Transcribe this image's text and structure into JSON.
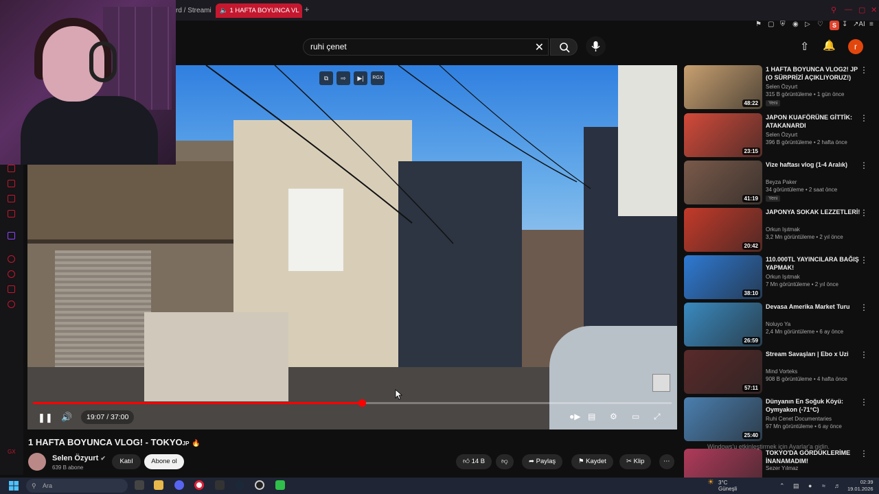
{
  "browser": {
    "prev_tab_label": "rd / Streami",
    "active_tab_label": "1 HAFTA BOYUNCA VL",
    "new_tab_icon": "plus-icon",
    "accent": "#c4182f"
  },
  "search": {
    "value": "ruhi çenet",
    "clear_icon": "close-icon",
    "search_icon": "search-icon",
    "mic_icon": "mic-icon"
  },
  "header": {
    "upload_icon": "upload-icon",
    "bell_icon": "bell-icon",
    "avatar_letter": "r"
  },
  "player": {
    "current_time": "19:07",
    "duration": "37:00",
    "time_display": "19:07 / 37:00",
    "progress_fraction": 0.515,
    "top_icons": [
      "copy-icon",
      "pip-icon",
      "next-icon",
      "RGX"
    ],
    "accent": "#ff0000"
  },
  "video": {
    "title": "1 HAFTA BOYUNCA VLOG! - TOKYO",
    "title_suffix": "JP",
    "channel": "Selen Özyurt",
    "subscribers": "639 B abone",
    "join_label": "Katıl",
    "subscribe_label": "Abone ol",
    "likes": "14 B",
    "share_label": "Paylaş",
    "save_label": "Kaydet",
    "clip_label": "Klip"
  },
  "recommendations": [
    {
      "title": "1 HAFTA BOYUNCA VLOG2! JP (O SÜRPRİZİ AÇIKLIYORUZ!)",
      "channel": "Selen Özyurt",
      "meta": "315 B görüntüleme • 1 gün önce",
      "duration": "48:22",
      "badge": "Yeni",
      "color": "#c8a070"
    },
    {
      "title": "JAPON KUAFÖRÜNE GİTTİK: ATAKANARDI",
      "channel": "Selen Özyurt",
      "meta": "396 B görüntüleme • 2 hafta önce",
      "duration": "23:15",
      "badge": "",
      "color": "#d34a3a"
    },
    {
      "title": "Vize haftası vlog (1-4 Aralık)",
      "channel": "Beyza Paker",
      "meta": "34 görüntüleme • 2 saat önce",
      "duration": "41:19",
      "badge": "Yeni",
      "color": "#7a5a4a"
    },
    {
      "title": "JAPONYA SOKAK LEZZETLERİ!",
      "channel": "Orkun Işıtmak",
      "meta": "3,2 Mn görüntüleme • 2 yıl önce",
      "duration": "20:42",
      "badge": "",
      "color": "#c43a2a"
    },
    {
      "title": "110.000TL YAYINCILARA BAĞIŞ YAPMAK!",
      "channel": "Orkun Işıtmak",
      "meta": "7 Mn görüntüleme • 2 yıl önce",
      "duration": "38:10",
      "badge": "",
      "color": "#2e7ad4"
    },
    {
      "title": "Devasa Amerika Market Turu",
      "channel": "Noluyo Ya",
      "meta": "2,4 Mn görüntüleme • 6 ay önce",
      "duration": "26:59",
      "badge": "",
      "color": "#3a8ac0"
    },
    {
      "title": "Stream Savaşları | Ebo x Uzi",
      "channel": "Mind Vorteks",
      "meta": "908 B görüntüleme • 4 hafta önce",
      "duration": "57:11",
      "badge": "",
      "color": "#5a2a2a"
    },
    {
      "title": "Dünyanın En Soğuk Köyü: Oymyakon (-71°C)",
      "channel": "Ruhi Cenet Documentaries",
      "meta": "97 Mn görüntüleme • 6 ay önce",
      "duration": "25:40",
      "badge": "",
      "color": "#4a7fb0"
    },
    {
      "title": "TOKYO'DA GÖRDÜKLERİME İNANAMADIM!",
      "channel": "Sezer Yılmaz",
      "meta": "",
      "duration": "",
      "badge": "",
      "color": "#b03a5a"
    }
  ],
  "watermark": {
    "line1": "Windows'u etkinleştirmek için Ayarlar'a gidin."
  },
  "taskbar": {
    "search_placeholder": "Ara",
    "temperature": "3°C",
    "weather_desc": "Güneşli",
    "time": "02:39",
    "date": "19.01.2026"
  }
}
